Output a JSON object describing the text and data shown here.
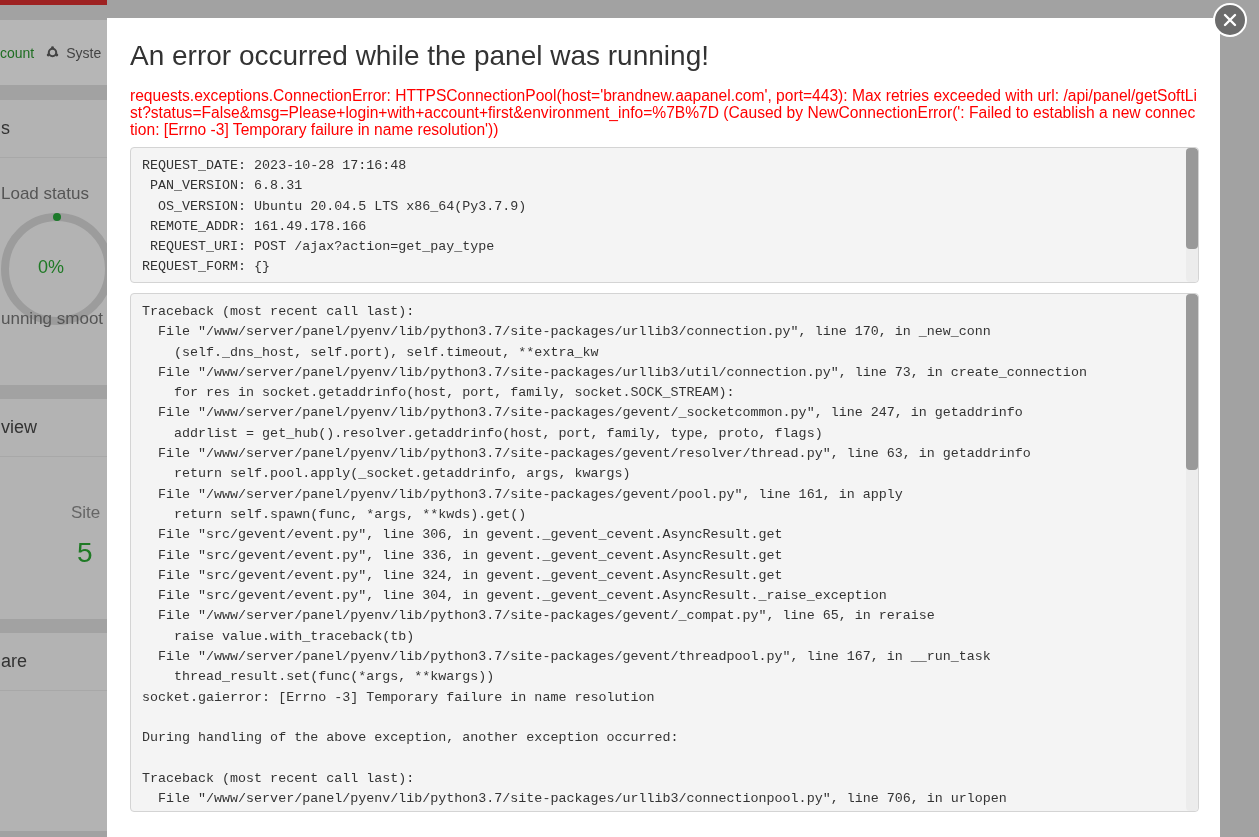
{
  "background": {
    "nav": [
      {
        "label": "count",
        "selected": true,
        "kind": "link"
      },
      {
        "label": "Syste",
        "selected": false,
        "kind": "gear"
      }
    ],
    "panels": [
      {
        "title": "s",
        "kind": "load",
        "label": "Load status",
        "value": "0%",
        "status": "unning smoot"
      },
      {
        "title": "view",
        "kind": "stat",
        "label": "Site",
        "value": "5"
      },
      {
        "title": "are",
        "kind": "empty"
      }
    ]
  },
  "dialog": {
    "title": "An error occurred while the panel was running!",
    "error_message": "requests.exceptions.ConnectionError: HTTPSConnectionPool(host='brandnew.aapanel.com', port=443): Max retries exceeded with url: /api/panel/getSoftList?status=False&msg=Please+login+with+account+first&environment_info=%7B%7D (Caused by NewConnectionError(': Failed to establish a new connection: [Errno -3] Temporary failure in name resolution'))",
    "info_lines": [
      "REQUEST_DATE: 2023-10-28 17:16:48",
      " PAN_VERSION: 6.8.31",
      "  OS_VERSION: Ubuntu 20.04.5 LTS x86_64(Py3.7.9)",
      " REMOTE_ADDR: 161.49.178.166",
      " REQUEST_URI: POST /ajax?action=get_pay_type",
      "REQUEST_FORM: {}"
    ],
    "traceback_lines": [
      "Traceback (most recent call last):",
      "  File \"/www/server/panel/pyenv/lib/python3.7/site-packages/urllib3/connection.py\", line 170, in _new_conn",
      "    (self._dns_host, self.port), self.timeout, **extra_kw",
      "  File \"/www/server/panel/pyenv/lib/python3.7/site-packages/urllib3/util/connection.py\", line 73, in create_connection",
      "    for res in socket.getaddrinfo(host, port, family, socket.SOCK_STREAM):",
      "  File \"/www/server/panel/pyenv/lib/python3.7/site-packages/gevent/_socketcommon.py\", line 247, in getaddrinfo",
      "    addrlist = get_hub().resolver.getaddrinfo(host, port, family, type, proto, flags)",
      "  File \"/www/server/panel/pyenv/lib/python3.7/site-packages/gevent/resolver/thread.py\", line 63, in getaddrinfo",
      "    return self.pool.apply(_socket.getaddrinfo, args, kwargs)",
      "  File \"/www/server/panel/pyenv/lib/python3.7/site-packages/gevent/pool.py\", line 161, in apply",
      "    return self.spawn(func, *args, **kwds).get()",
      "  File \"src/gevent/event.py\", line 306, in gevent._gevent_cevent.AsyncResult.get",
      "  File \"src/gevent/event.py\", line 336, in gevent._gevent_cevent.AsyncResult.get",
      "  File \"src/gevent/event.py\", line 324, in gevent._gevent_cevent.AsyncResult.get",
      "  File \"src/gevent/event.py\", line 304, in gevent._gevent_cevent.AsyncResult._raise_exception",
      "  File \"/www/server/panel/pyenv/lib/python3.7/site-packages/gevent/_compat.py\", line 65, in reraise",
      "    raise value.with_traceback(tb)",
      "  File \"/www/server/panel/pyenv/lib/python3.7/site-packages/gevent/threadpool.py\", line 167, in __run_task",
      "    thread_result.set(func(*args, **kwargs))",
      "socket.gaierror: [Errno -3] Temporary failure in name resolution",
      {
        "text": "During handling of the above exception, another exception occurred:",
        "gap_before": true
      },
      {
        "text": "Traceback (most recent call last):",
        "gap_before": true
      },
      "  File \"/www/server/panel/pyenv/lib/python3.7/site-packages/urllib3/connectionpool.py\", line 706, in urlopen"
    ]
  }
}
